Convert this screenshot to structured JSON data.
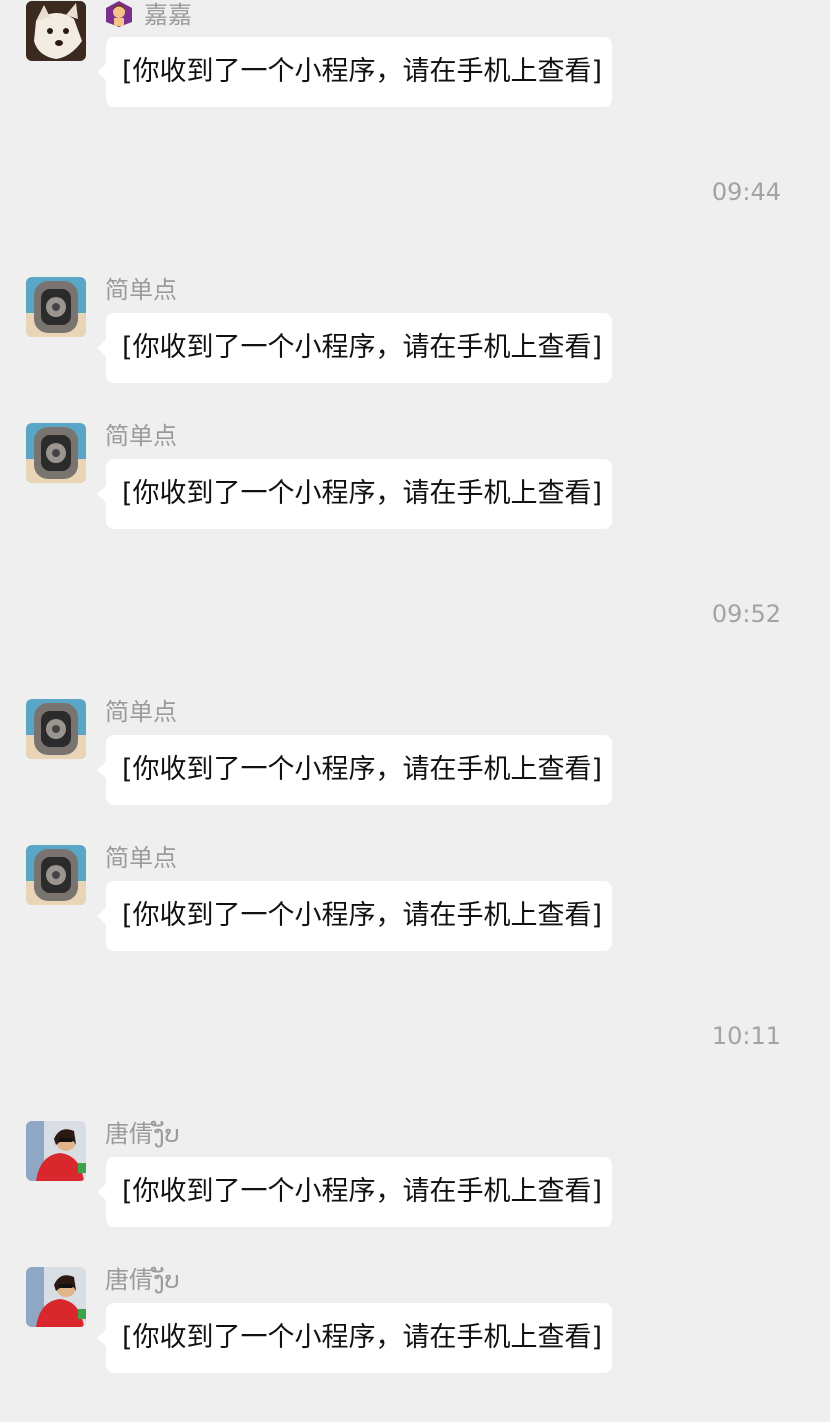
{
  "messages": [
    {
      "sender": "嘉嘉",
      "text": "[你收到了一个小程序，请在手机上查看]",
      "avatar": "dog-avatar",
      "emoji": "woman-gesturing-icon"
    },
    {
      "sender": "简单点",
      "text": "[你收到了一个小程序，请在手机上查看]",
      "avatar": "watch-avatar"
    },
    {
      "sender": "简单点",
      "text": "[你收到了一个小程序，请在手机上查看]",
      "avatar": "watch-avatar"
    },
    {
      "sender": "简单点",
      "text": "[你收到了一个小程序，请在手机上查看]",
      "avatar": "watch-avatar"
    },
    {
      "sender": "简单点",
      "text": "[你收到了一个小程序，请在手机上查看]",
      "avatar": "watch-avatar"
    },
    {
      "sender": "唐倩ງັບ",
      "text": "[你收到了一个小程序，请在手机上查看]",
      "avatar": "woman-photo-avatar"
    },
    {
      "sender": "唐倩ງັບ",
      "text": "[你收到了一个小程序，请在手机上查看]",
      "avatar": "woman-photo-avatar"
    }
  ],
  "timestamps": [
    "09:44",
    "09:52",
    "10:11"
  ],
  "colors": {
    "background": "#efefef",
    "bubble": "#ffffff",
    "sender_text": "#9b9b9b",
    "message_text": "#111111",
    "timestamp_text": "#a3a3a3"
  }
}
